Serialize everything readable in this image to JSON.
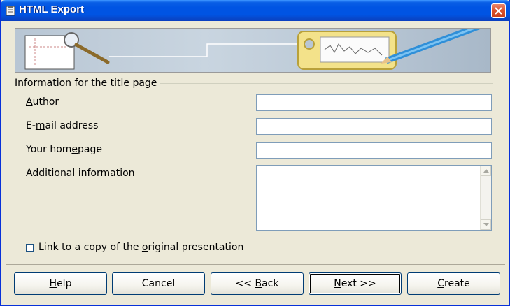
{
  "window": {
    "title": "HTML Export"
  },
  "banner": {
    "icons": [
      "document-magnifier-graphic",
      "tag-pencil-graphic"
    ]
  },
  "group": {
    "title": "Information for the title page"
  },
  "fields": {
    "author": {
      "label_pre": "",
      "label_mn": "A",
      "label_post": "uthor",
      "value": ""
    },
    "email": {
      "label_pre": "E-",
      "label_mn": "m",
      "label_post": "ail address",
      "value": ""
    },
    "homepage": {
      "label_pre": "Your hom",
      "label_mn": "e",
      "label_post": "page",
      "value": ""
    },
    "additional": {
      "label_pre": "Additional ",
      "label_mn": "i",
      "label_post": "nformation",
      "value": ""
    }
  },
  "checkbox": {
    "label_pre": "Link to a copy of the ",
    "label_mn": "o",
    "label_post": "riginal presentation",
    "checked": false
  },
  "buttons": {
    "help": {
      "pre": "",
      "mn": "H",
      "post": "elp"
    },
    "cancel": {
      "pre": "Cancel",
      "mn": "",
      "post": ""
    },
    "back": {
      "pre": "<< ",
      "mn": "B",
      "post": "ack"
    },
    "next": {
      "pre": "",
      "mn": "N",
      "post": "ext >>"
    },
    "create": {
      "pre": "",
      "mn": "C",
      "post": "reate"
    }
  },
  "colors": {
    "titlebar": "#0054e3",
    "dialog_bg": "#ece9d8",
    "input_border": "#7f9db9",
    "close_button": "#d9512c"
  }
}
